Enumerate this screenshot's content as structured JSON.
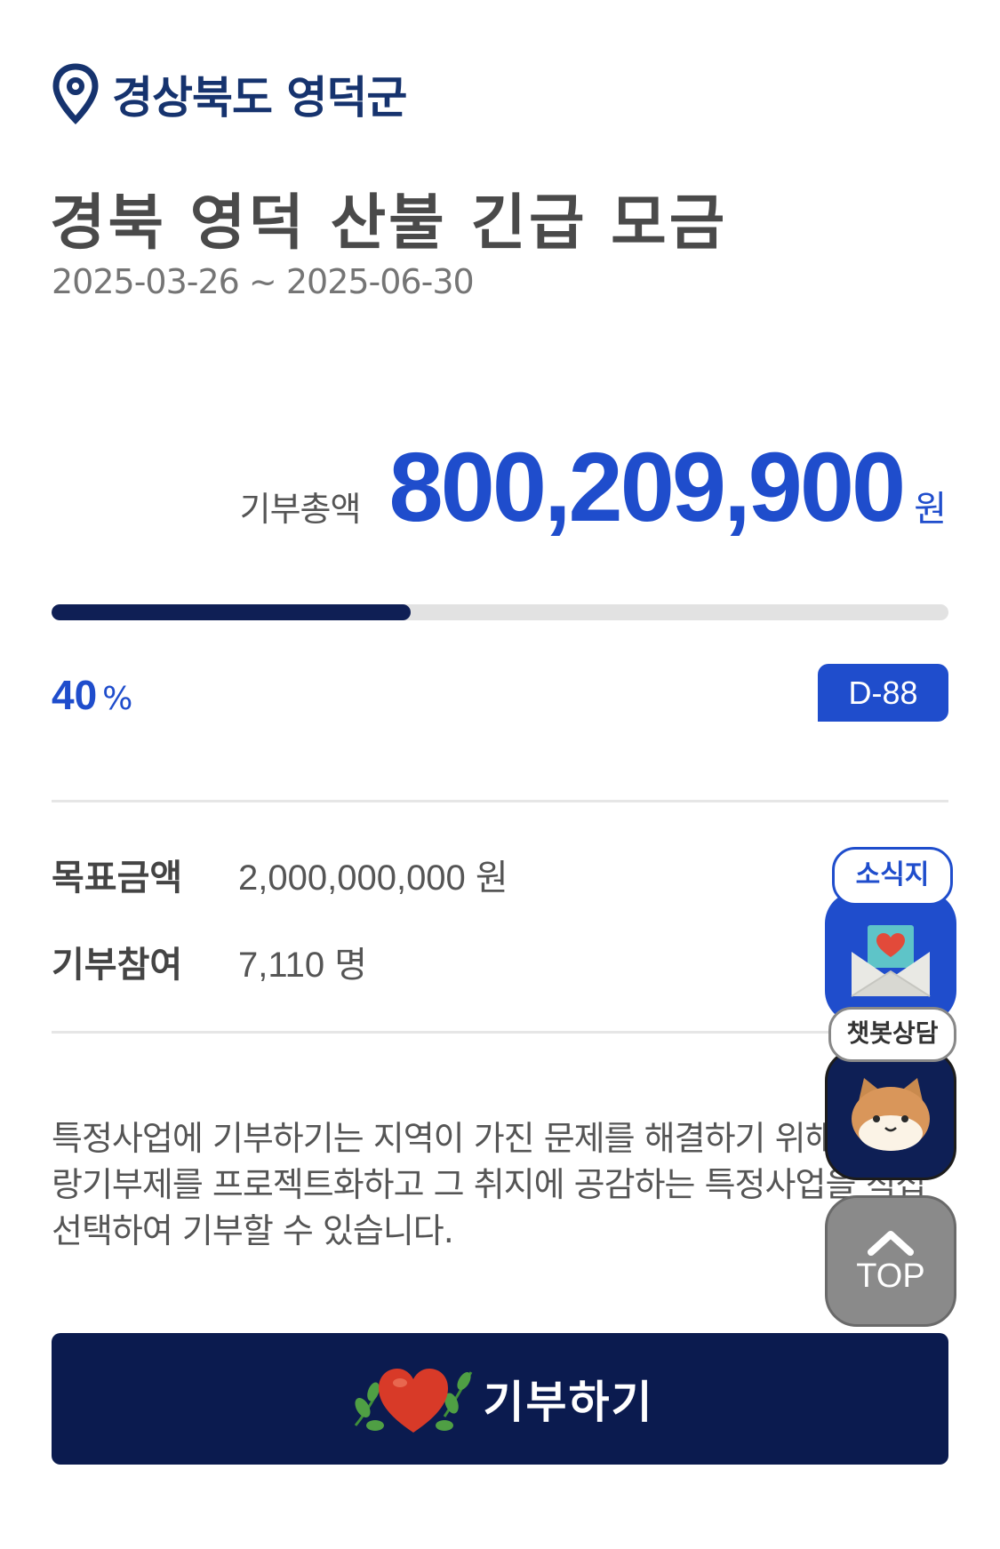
{
  "location": "경상북도 영덕군",
  "title": "경북 영덕 산불 긴급 모금",
  "period": "2025-03-26 ~ 2025-06-30",
  "total": {
    "label": "기부총액",
    "value": "800,209,900",
    "unit": "원"
  },
  "progress": {
    "percent": "40",
    "percent_sign": "%",
    "fraction": 0.4
  },
  "dday": "D-88",
  "info": [
    {
      "label": "목표금액",
      "value": "2,000,000,000 원"
    },
    {
      "label": "기부참여",
      "value": "7,110 명"
    }
  ],
  "description": "특정사업에 기부하기는 지역이 가진 문제를 해결하기 위해 고향사랑기부제를 프로젝트화하고 그 취지에 공감하는 특정사업을 직접 선택하여 기부할 수 있습니다.",
  "donate_button": "기부하기",
  "floating": {
    "news": "소식지",
    "chatbot": "챗봇상담",
    "top": "TOP"
  },
  "colors": {
    "primary": "#1f4dcc",
    "navy": "#0b1b4f",
    "progress_fill": "#0f1f55"
  },
  "icons": [
    "location-pin-icon",
    "heart-leaves-icon",
    "envelope-heart-icon",
    "cat-face-icon",
    "chevron-up-icon"
  ]
}
